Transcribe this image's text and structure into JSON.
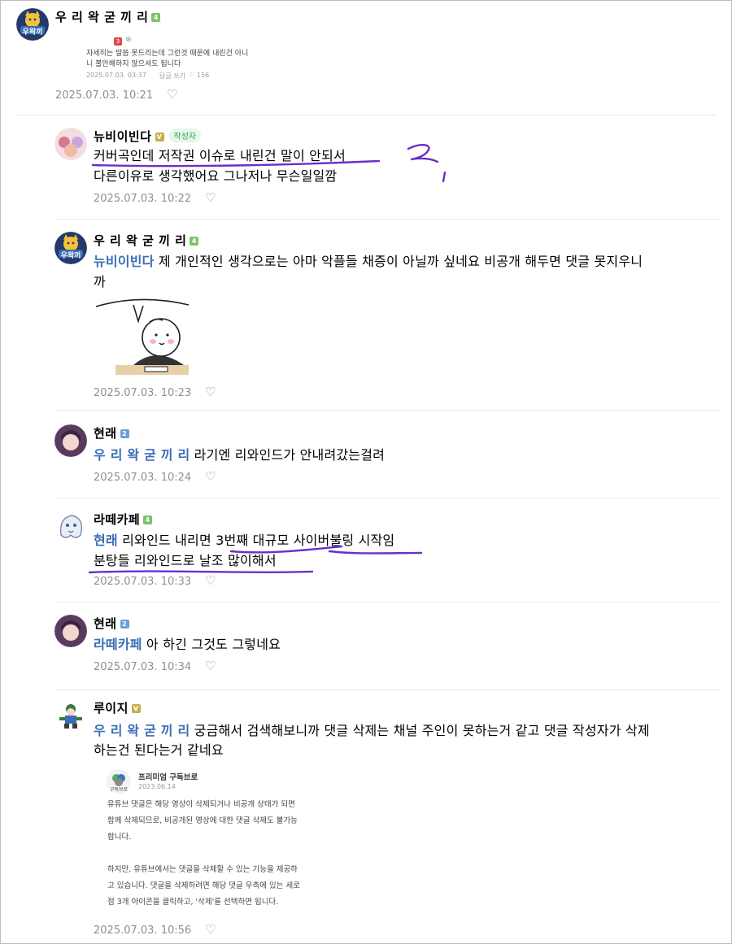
{
  "comments": [
    {
      "author": "우 리 왁 굳 끼 리",
      "level": "4",
      "embedded": {
        "badge": "3",
        "lines": [
          "자세히는 말씀 못드리는데 그런것 때문에 내린건 아니",
          "니 불안해하지 않으셔도 됩니다"
        ],
        "date": "2025.07.03. 03:37",
        "reply": "답글 쓰기",
        "likes": "156"
      },
      "date": "2025.07.03. 10:21"
    },
    {
      "author": "뉴비이빈다",
      "level": "V",
      "author_tag": "작성자",
      "lines": [
        "커버곡인데 저작권 이슈로 내린건 말이 안되서",
        "다른이유로 생각했어요 그나저나 무슨일일깜"
      ],
      "date": "2025.07.03. 10:22"
    },
    {
      "author": "우 리 왁 굳 끼 리",
      "level": "4",
      "mention": "뉴비이빈다",
      "lines": [
        "제 개인적인 생각으로는 아마 악플들 채증이 아닐까 싶네요 비공개 해두면 댓글 못지우니",
        "까"
      ],
      "date": "2025.07.03. 10:23"
    },
    {
      "author": "현래",
      "level": "2",
      "mention": "우 리 왁 굳 끼 리",
      "lines": [
        "라기엔 리와인드가 안내려갔는걸려"
      ],
      "date": "2025.07.03. 10:24"
    },
    {
      "author": "라떼카페",
      "level": "4",
      "mention": "현래",
      "lines": [
        "리와인드 내리면 3번째 대규모 사이버불링 시작임",
        "분탕들 리와인드로 날조 많이해서"
      ],
      "date": "2025.07.03. 10:33"
    },
    {
      "author": "현래",
      "level": "2",
      "mention": "라떼카페",
      "lines": [
        "아 하긴 그것도 그렇네요"
      ],
      "date": "2025.07.03. 10:34"
    },
    {
      "author": "루이지",
      "level": "V",
      "mention": "우 리 왁 굳 끼 리",
      "lines": [
        "궁금해서 검색해보니까 댓글 삭제는 채널 주인이 못하는거 같고 댓글 작성자가 삭제",
        "하는건 된다는거 같네요"
      ],
      "embedded": {
        "title": "프리미엄 구독브로",
        "date": "2023.06.14",
        "lines": [
          "유튜브 댓글은 해당 영상이 삭제되거나 비공개 상태가 되면",
          "함께 삭제되므로, 비공개된 영상에 대한 댓글 삭제도 불가능",
          "합니다.",
          "",
          "하지만, 유튜브에서는 댓글을 삭제할 수 있는 기능을 제공하",
          "고 있습니다. 댓글을 삭제하려면 해당 댓글 우측에 있는 세로",
          "점 3개 아이콘을 클릭하고, '삭제'를 선택하면 됩니다."
        ]
      },
      "date": "2025.07.03. 10:56"
    }
  ],
  "avatar_logo_text": "우왁끼",
  "embedded_logo_text": "구독브로",
  "colors": {
    "mention": "#3a6db5",
    "underline": "#6b2fc9",
    "date": "#8f8f8f",
    "divider": "#e7e7e7"
  },
  "icons": {
    "like": "heart-outline-icon"
  }
}
